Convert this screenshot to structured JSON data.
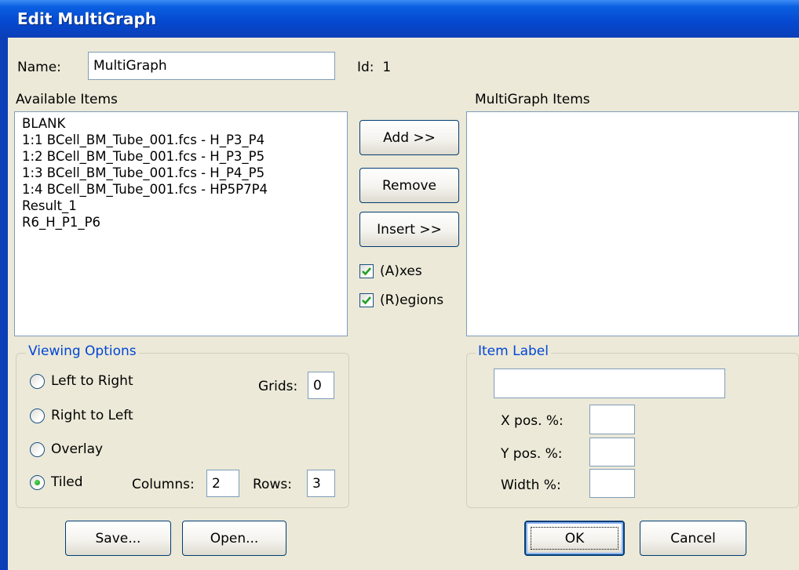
{
  "window": {
    "title": "Edit MultiGraph"
  },
  "name": {
    "label": "Name:",
    "value": "MultiGraph"
  },
  "id": {
    "label": "Id:",
    "value": "1"
  },
  "available": {
    "label": "Available Items",
    "items": [
      "BLANK",
      "1:1  BCell_BM_Tube_001.fcs - H_P3_P4",
      "1:2  BCell_BM_Tube_001.fcs - H_P3_P5",
      "1:3  BCell_BM_Tube_001.fcs - H_P4_P5",
      "1:4  BCell_BM_Tube_001.fcs - HP5P7P4",
      "Result_1",
      "R6_H_P1_P6"
    ]
  },
  "multigraph": {
    "label": "MultiGraph Items",
    "items": []
  },
  "buttons": {
    "add": "Add >>",
    "remove": "Remove",
    "insert": "Insert >>",
    "save": "Save...",
    "open": "Open...",
    "ok": "OK",
    "cancel": "Cancel"
  },
  "checks": {
    "axes": {
      "label": "(A)xes",
      "checked": true
    },
    "regions": {
      "label": "(R)egions",
      "checked": true
    }
  },
  "viewing": {
    "legend": "Viewing Options",
    "options": {
      "ltr": {
        "label": "Left to Right",
        "selected": false
      },
      "rtl": {
        "label": "Right to Left",
        "selected": false
      },
      "overlay": {
        "label": "Overlay",
        "selected": false
      },
      "tiled": {
        "label": "Tiled",
        "selected": true
      }
    },
    "grids": {
      "label": "Grids:",
      "value": "0"
    },
    "columns": {
      "label": "Columns:",
      "value": "2"
    },
    "rows": {
      "label": "Rows:",
      "value": "3"
    }
  },
  "item_label": {
    "legend": "Item Label",
    "value": "",
    "xpos": {
      "label": "X pos. %:",
      "value": ""
    },
    "ypos": {
      "label": "Y pos. %:",
      "value": ""
    },
    "width": {
      "label": "Width %:",
      "value": ""
    }
  },
  "colors": {
    "title_bar": "#0548cf",
    "dialog_bg": "#ece9d8",
    "group_legend": "#0046d5",
    "radio_dot": "#21a121",
    "check_mark": "#21a121"
  }
}
